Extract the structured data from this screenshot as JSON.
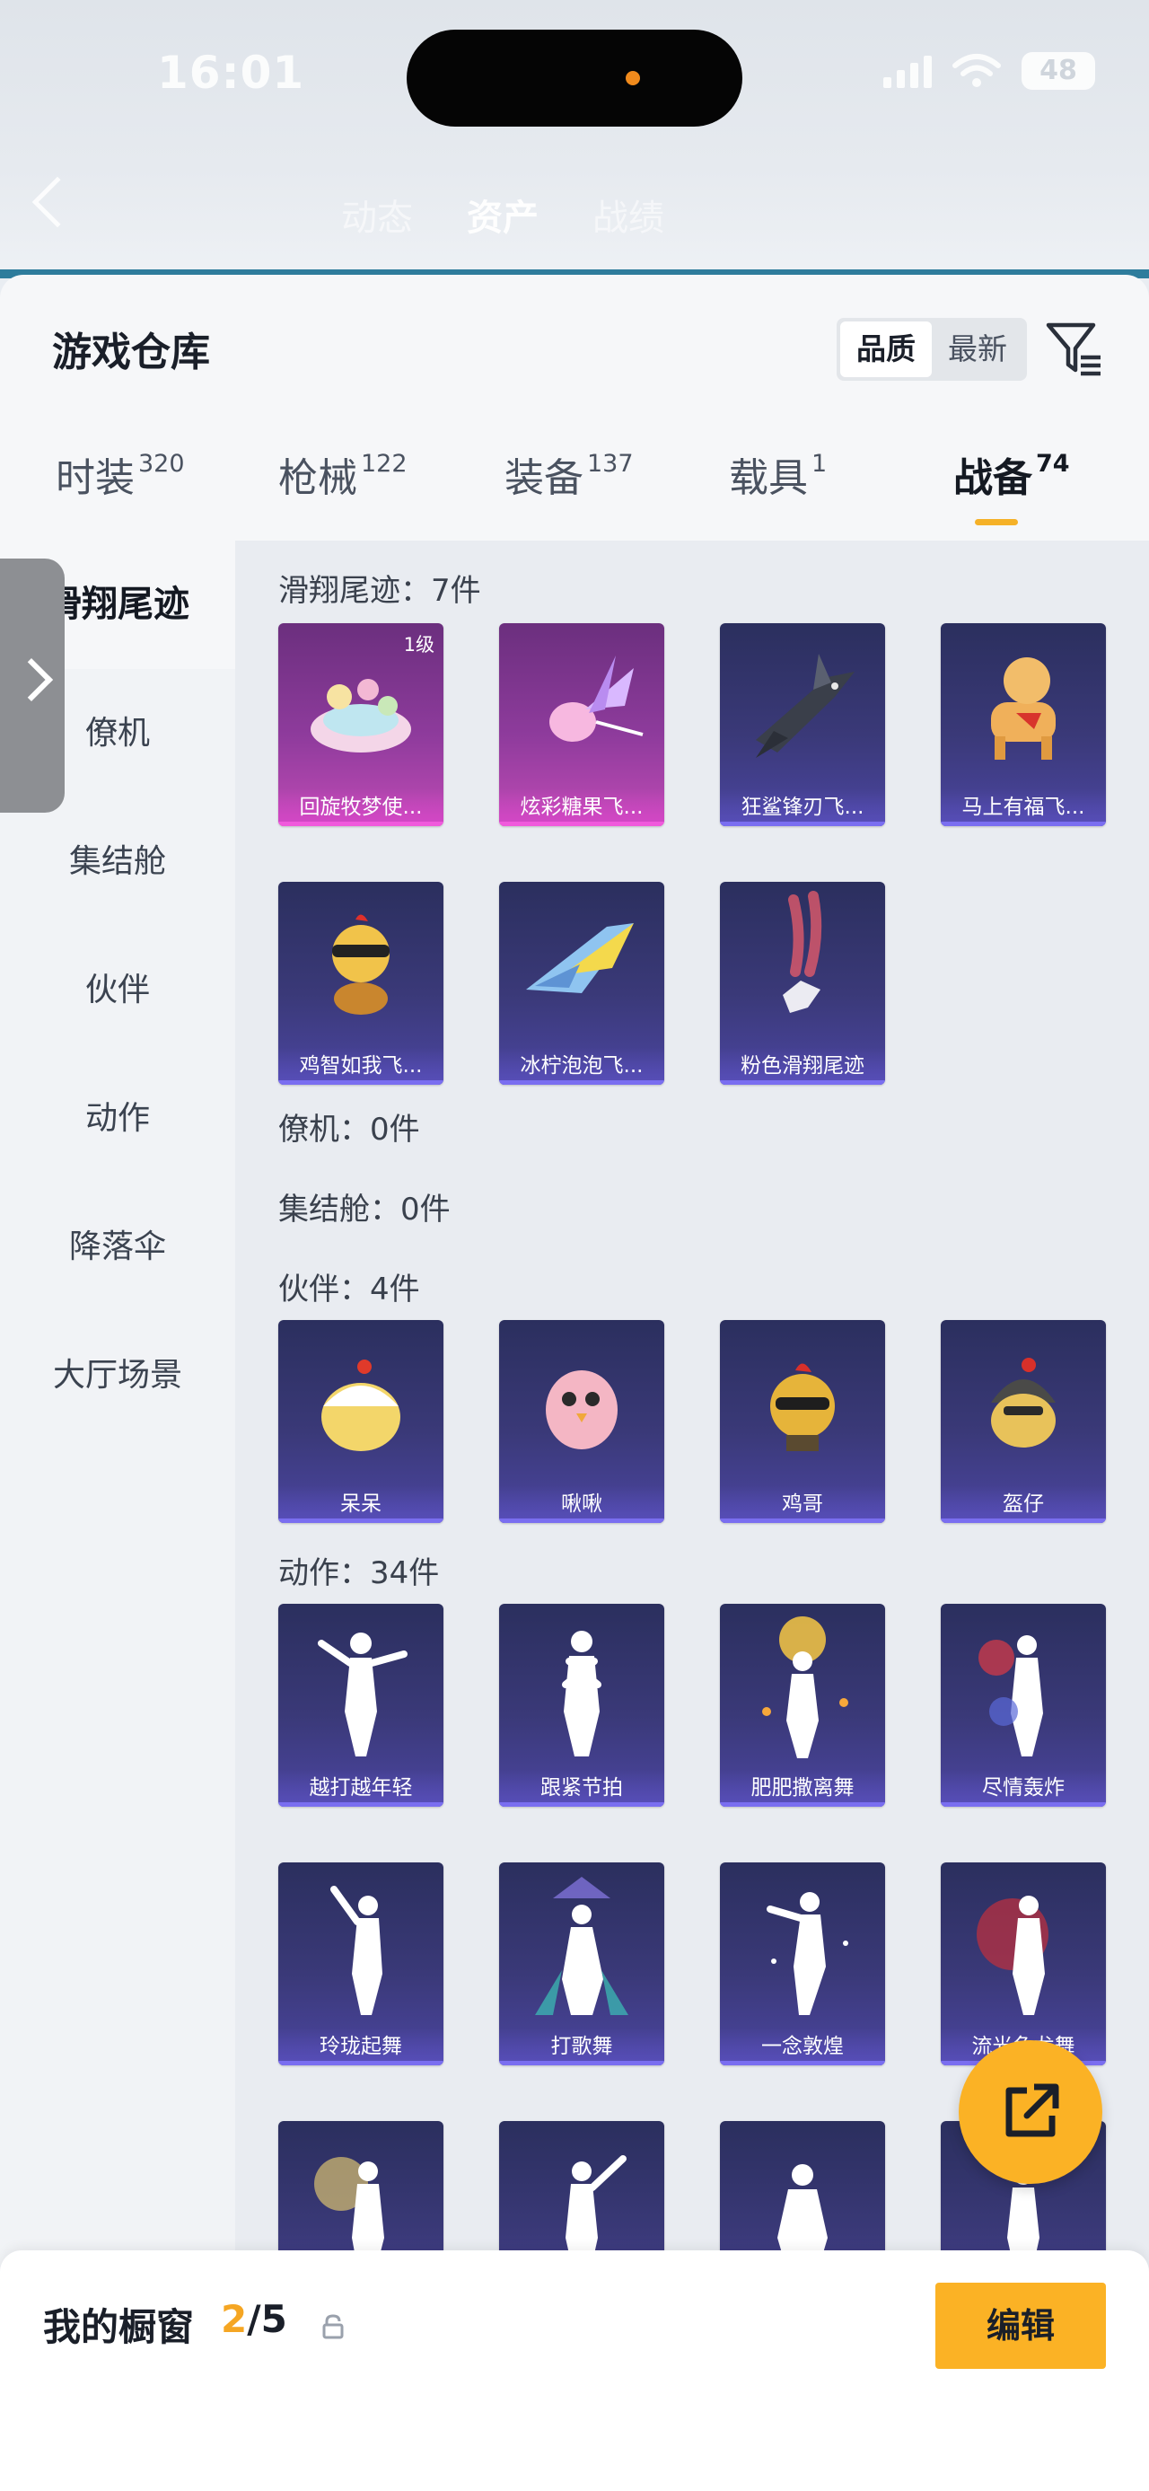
{
  "status_bar": {
    "time": "16:01",
    "battery": "48"
  },
  "header": {
    "tabs": [
      {
        "label": "动态"
      },
      {
        "label": "资产"
      },
      {
        "label": "战绩"
      }
    ]
  },
  "panel": {
    "title": "游戏仓库",
    "sort_options": [
      {
        "label": "品质",
        "selected": true
      },
      {
        "label": "最新",
        "selected": false
      }
    ],
    "category_tabs": [
      {
        "label": "时装",
        "count": "320"
      },
      {
        "label": "枪械",
        "count": "122"
      },
      {
        "label": "装备",
        "count": "137"
      },
      {
        "label": "载具",
        "count": "1"
      },
      {
        "label": "战备",
        "count": "74",
        "selected": true
      }
    ]
  },
  "sidebar": {
    "items": [
      {
        "label": "滑翔尾迹",
        "selected": true
      },
      {
        "label": "僚机"
      },
      {
        "label": "集结舱"
      },
      {
        "label": "伙伴"
      },
      {
        "label": "动作"
      },
      {
        "label": "降落伞"
      },
      {
        "label": "大厅场景"
      }
    ]
  },
  "sections": [
    {
      "title": "滑翔尾迹：7件",
      "items": [
        {
          "name": "回旋牧梦使...",
          "badge": "1级",
          "rarity": "legendary"
        },
        {
          "name": "炫彩糖果飞...",
          "rarity": "legendary"
        },
        {
          "name": "狂鲨锋刃飞...",
          "rarity": "epic"
        },
        {
          "name": "马上有福飞...",
          "rarity": "epic"
        },
        {
          "name": "鸡智如我飞...",
          "rarity": "epic"
        },
        {
          "name": "冰柠泡泡飞...",
          "rarity": "epic"
        },
        {
          "name": "粉色滑翔尾迹",
          "rarity": "epic"
        }
      ]
    },
    {
      "title": "僚机：0件",
      "items": []
    },
    {
      "title": "集结舱：0件",
      "items": []
    },
    {
      "title": "伙伴：4件",
      "items": [
        {
          "name": "呆呆",
          "rarity": "epic"
        },
        {
          "name": "啾啾",
          "rarity": "epic"
        },
        {
          "name": "鸡哥",
          "rarity": "epic"
        },
        {
          "name": "盔仔",
          "rarity": "epic"
        }
      ]
    },
    {
      "title": "动作：34件",
      "items": [
        {
          "name": "越打越年轻",
          "rarity": "epic"
        },
        {
          "name": "跟紧节拍",
          "rarity": "epic"
        },
        {
          "name": "肥肥撒离舞",
          "rarity": "epic"
        },
        {
          "name": "尽情轰炸",
          "rarity": "epic"
        },
        {
          "name": "玲珑起舞",
          "rarity": "epic"
        },
        {
          "name": "打歌舞",
          "rarity": "epic"
        },
        {
          "name": "一念敦煌",
          "rarity": "epic"
        },
        {
          "name": "流光鱼龙舞",
          "rarity": "epic"
        },
        {
          "name": "",
          "rarity": "epic"
        },
        {
          "name": "",
          "rarity": "epic"
        },
        {
          "name": "",
          "rarity": "epic"
        },
        {
          "name": "",
          "rarity": "epic"
        }
      ]
    }
  ],
  "showcase": {
    "title": "我的橱窗",
    "count_current": "2",
    "count_total": "/5",
    "edit_label": "编辑"
  },
  "icons": {
    "back": "chevron-left-icon",
    "filter": "filter-icon",
    "side_toggle": "chevron-right-icon",
    "share": "share-external-icon",
    "lock": "lock-icon"
  }
}
